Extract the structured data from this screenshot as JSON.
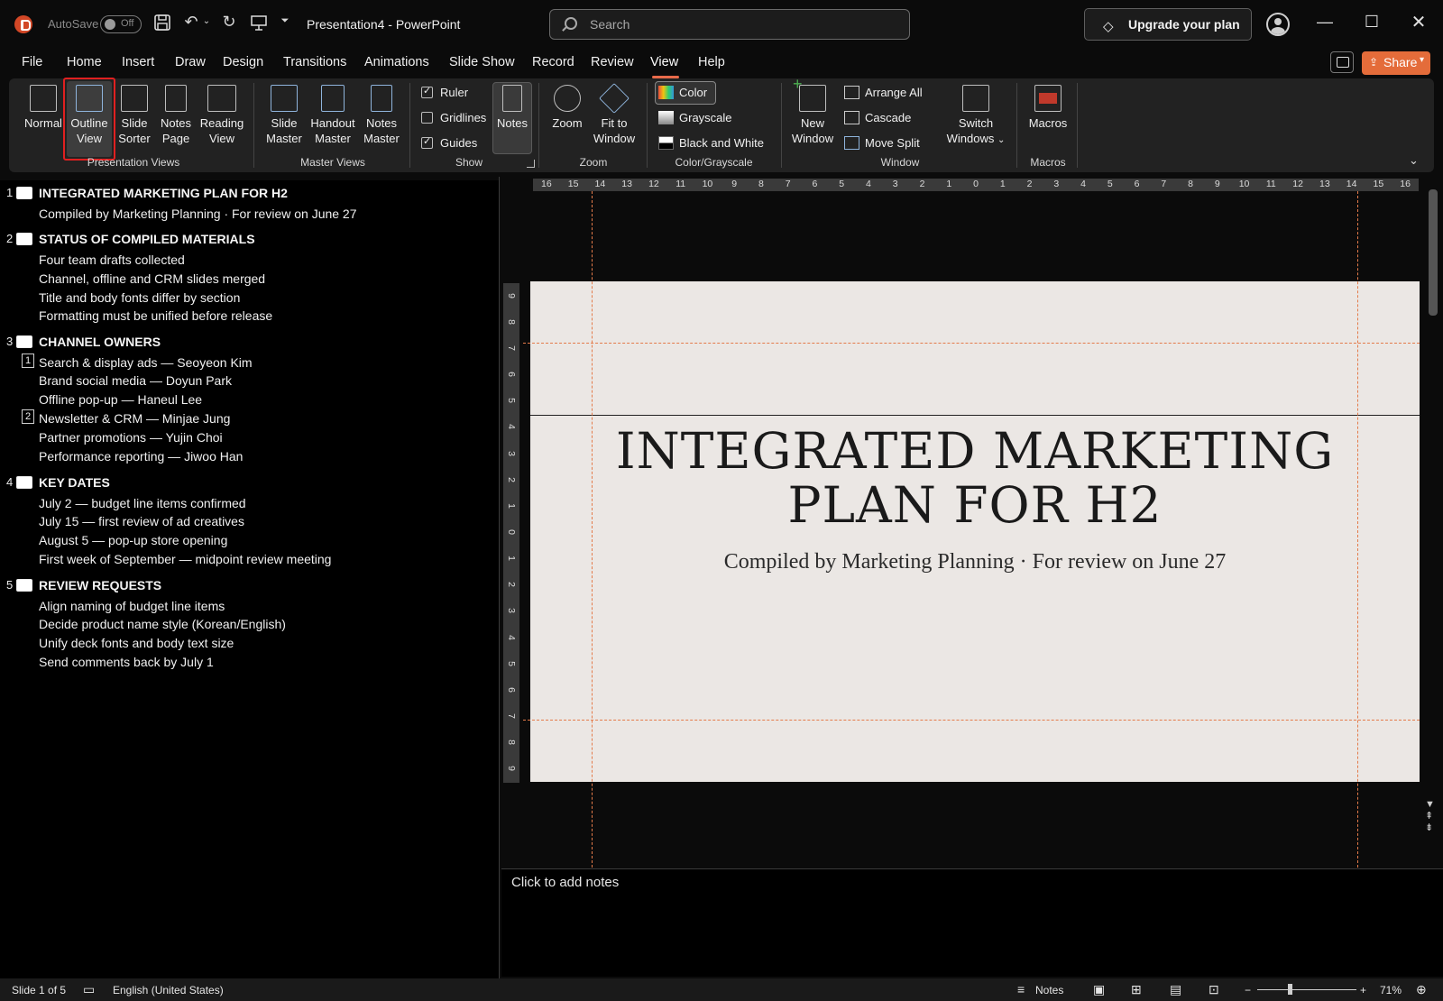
{
  "titlebar": {
    "autosave_label": "AutoSave",
    "autosave_state": "Off",
    "doc_title": "Presentation4  -  PowerPoint",
    "search_placeholder": "Search",
    "upgrade_label": "Upgrade your plan",
    "brand_color": "#d24726"
  },
  "menu": {
    "tabs": [
      "File",
      "Home",
      "Insert",
      "Draw",
      "Design",
      "Transitions",
      "Animations",
      "Slide Show",
      "Record",
      "Review",
      "View",
      "Help"
    ],
    "active_tab": "View",
    "share_label": "Share",
    "share_color": "#e46c3a"
  },
  "ribbon": {
    "presentation_views": {
      "label": "Presentation Views",
      "buttons": [
        {
          "line1": "Normal",
          "line2": ""
        },
        {
          "line1": "Outline",
          "line2": "View"
        },
        {
          "line1": "Slide",
          "line2": "Sorter"
        },
        {
          "line1": "Notes",
          "line2": "Page"
        },
        {
          "line1": "Reading",
          "line2": "View"
        }
      ],
      "selected": "Outline View"
    },
    "master_views": {
      "label": "Master Views",
      "buttons": [
        {
          "line1": "Slide",
          "line2": "Master"
        },
        {
          "line1": "Handout",
          "line2": "Master"
        },
        {
          "line1": "Notes",
          "line2": "Master"
        }
      ]
    },
    "show": {
      "label": "Show",
      "checkboxes": [
        {
          "label": "Ruler",
          "checked": true
        },
        {
          "label": "Gridlines",
          "checked": false
        },
        {
          "label": "Guides",
          "checked": true
        }
      ],
      "notes_label": "Notes"
    },
    "zoom": {
      "label": "Zoom",
      "zoom_label": "Zoom",
      "fit_line1": "Fit to",
      "fit_line2": "Window"
    },
    "color": {
      "label": "Color/Grayscale",
      "options": [
        "Color",
        "Grayscale",
        "Black and White"
      ],
      "selected": "Color"
    },
    "window": {
      "label": "Window",
      "new_line1": "New",
      "new_line2": "Window",
      "options": [
        "Arrange All",
        "Cascade",
        "Move Split"
      ],
      "switch_line1": "Switch",
      "switch_line2": "Windows"
    },
    "macros": {
      "label": "Macros",
      "button": "Macros"
    }
  },
  "outline": [
    {
      "num": "1",
      "title": "INTEGRATED MARKETING PLAN FOR H2",
      "items": [
        "Compiled by Marketing Planning · For review on June 27"
      ]
    },
    {
      "num": "2",
      "title": "STATUS OF COMPILED MATERIALS",
      "items": [
        "Four team drafts collected",
        "Channel, offline and CRM slides merged",
        "Title and body fonts differ by section",
        "Formatting must be unified before release"
      ]
    },
    {
      "num": "3",
      "title": "CHANNEL OWNERS",
      "items": [
        "Search & display ads — Seoyeon Kim",
        "Brand social media — Doyun Park",
        "Offline pop-up — Haneul Lee",
        "Newsletter & CRM — Minjae Jung",
        "Partner promotions — Yujin Choi",
        "Performance reporting — Jiwoo Han"
      ],
      "markers": [
        "1",
        "2"
      ]
    },
    {
      "num": "4",
      "title": "KEY DATES",
      "items": [
        "July 2 — budget line items confirmed",
        "July 15 — first review of ad creatives",
        "August 5 — pop-up store opening",
        "First week of September — midpoint review meeting"
      ]
    },
    {
      "num": "5",
      "title": "REVIEW REQUESTS",
      "items": [
        "Align naming of budget line items",
        "Decide product name style (Korean/English)",
        "Unify deck fonts and body text size",
        "Send comments back by July 1"
      ]
    }
  ],
  "slide": {
    "title_line1": "INTEGRATED MARKETING",
    "title_line2": "PLAN FOR H2",
    "subtitle": "Compiled by Marketing Planning · For review on June 27",
    "background": "#ebe7e4",
    "guide_color": "#e47b4a"
  },
  "rulers": {
    "horizontal": [
      "16",
      "15",
      "14",
      "13",
      "12",
      "11",
      "10",
      "9",
      "8",
      "7",
      "6",
      "5",
      "4",
      "3",
      "2",
      "1",
      "0",
      "1",
      "2",
      "3",
      "4",
      "5",
      "6",
      "7",
      "8",
      "9",
      "10",
      "11",
      "12",
      "13",
      "14",
      "15",
      "16"
    ],
    "vertical": [
      "9",
      "8",
      "7",
      "6",
      "5",
      "4",
      "3",
      "2",
      "1",
      "0",
      "1",
      "2",
      "3",
      "4",
      "5",
      "6",
      "7",
      "8",
      "9"
    ]
  },
  "notes": {
    "placeholder": "Click to add notes"
  },
  "status": {
    "slide_info": "Slide 1 of 5",
    "language": "English (United States)",
    "notes_label": "Notes",
    "zoom_minus": "−",
    "zoom_plus": "+",
    "zoom_level": "71%"
  }
}
